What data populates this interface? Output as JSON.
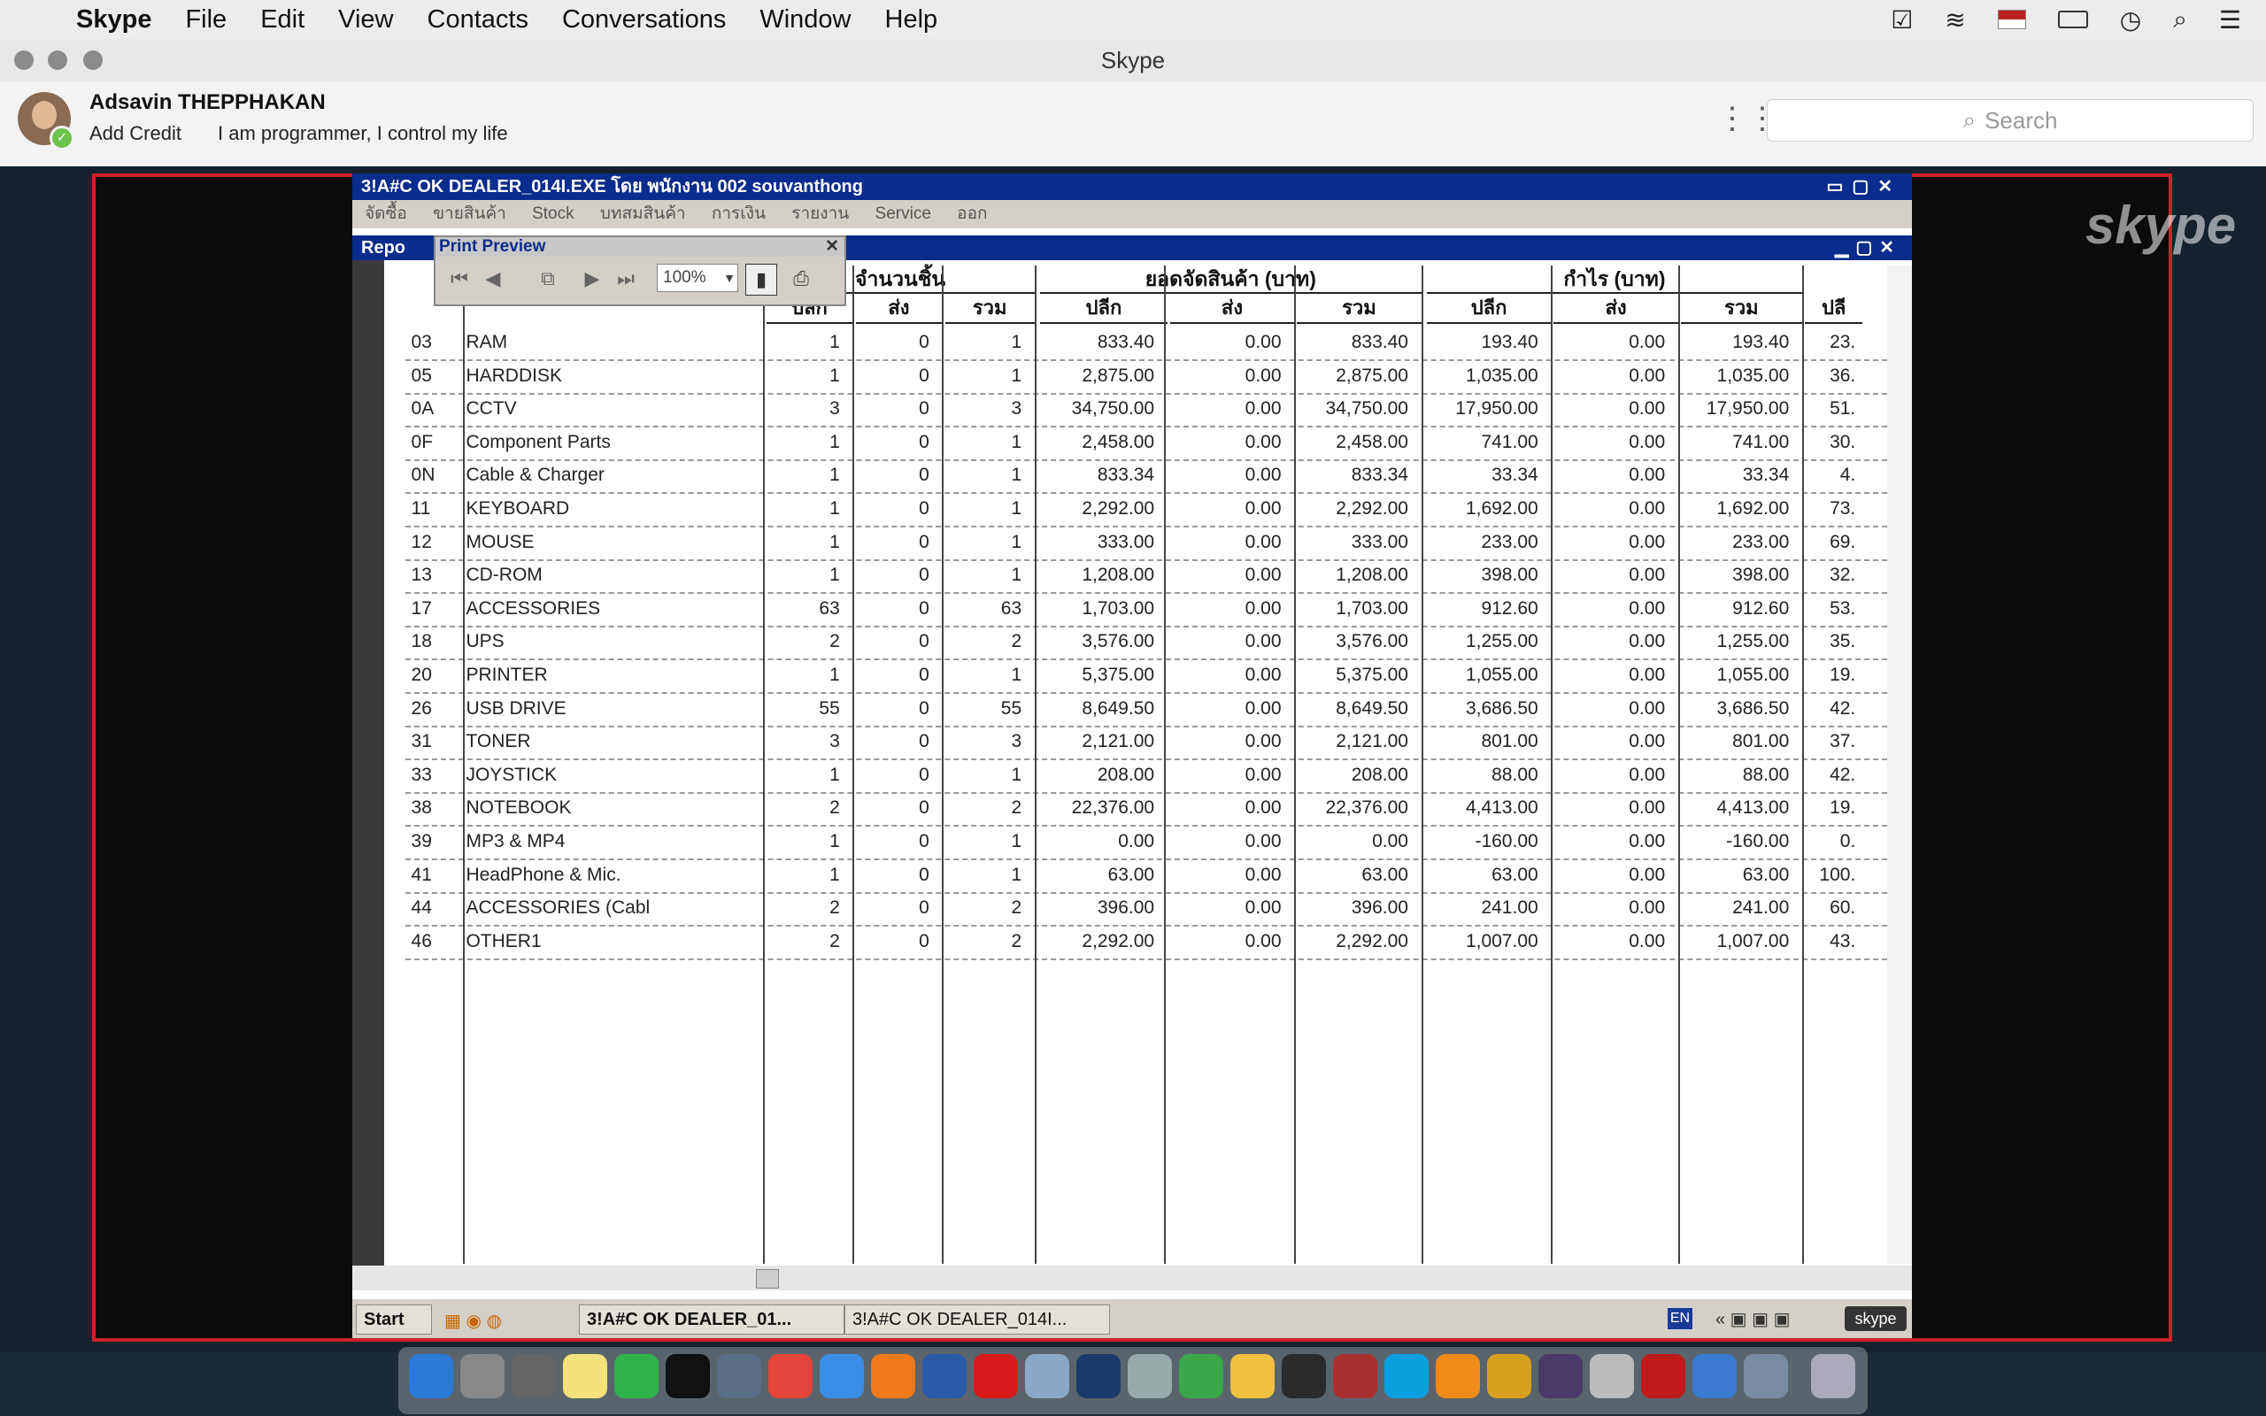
{
  "menubar": {
    "app": "Skype",
    "items": [
      "File",
      "Edit",
      "View",
      "Contacts",
      "Conversations",
      "Window",
      "Help"
    ]
  },
  "window": {
    "title": "Skype"
  },
  "profile": {
    "name": "Adsavin THEPPHAKAN",
    "add_credit": "Add Credit",
    "mood": "I am programmer, I control my life"
  },
  "search": {
    "placeholder": "Search"
  },
  "watermark": "skype",
  "app": {
    "title": "3!A#C OK DEALER_014I.EXE โดย พนักงาน 002 souvanthong",
    "menu": [
      "จัดซื้อ",
      "ขายสินค้า",
      "Stock",
      "บทสมสินค้า",
      "การเงิน",
      "รายงาน",
      "Service",
      "ออก"
    ],
    "report_label": "Repo",
    "print_preview": {
      "title": "Print Preview",
      "zoom": "100%"
    }
  },
  "table": {
    "groups": [
      "จำนวนชิ้น",
      "ยอดจัดสินค้า (บาท)",
      "กำไร (บาท)"
    ],
    "subheaders": [
      "ปลีก",
      "ส่ง",
      "รวม",
      "ปลีก",
      "ส่ง",
      "รวม",
      "ปลีก",
      "ส่ง",
      "รวม",
      "ปลี"
    ],
    "rows": [
      [
        "03",
        "RAM",
        "1",
        "0",
        "1",
        "833.40",
        "0.00",
        "833.40",
        "193.40",
        "0.00",
        "193.40",
        "23."
      ],
      [
        "05",
        "HARDDISK",
        "1",
        "0",
        "1",
        "2,875.00",
        "0.00",
        "2,875.00",
        "1,035.00",
        "0.00",
        "1,035.00",
        "36."
      ],
      [
        "0A",
        "CCTV",
        "3",
        "0",
        "3",
        "34,750.00",
        "0.00",
        "34,750.00",
        "17,950.00",
        "0.00",
        "17,950.00",
        "51."
      ],
      [
        "0F",
        "Component Parts",
        "1",
        "0",
        "1",
        "2,458.00",
        "0.00",
        "2,458.00",
        "741.00",
        "0.00",
        "741.00",
        "30."
      ],
      [
        "0N",
        "Cable & Charger",
        "1",
        "0",
        "1",
        "833.34",
        "0.00",
        "833.34",
        "33.34",
        "0.00",
        "33.34",
        "4."
      ],
      [
        "11",
        "KEYBOARD",
        "1",
        "0",
        "1",
        "2,292.00",
        "0.00",
        "2,292.00",
        "1,692.00",
        "0.00",
        "1,692.00",
        "73."
      ],
      [
        "12",
        "MOUSE",
        "1",
        "0",
        "1",
        "333.00",
        "0.00",
        "333.00",
        "233.00",
        "0.00",
        "233.00",
        "69."
      ],
      [
        "13",
        "CD-ROM",
        "1",
        "0",
        "1",
        "1,208.00",
        "0.00",
        "1,208.00",
        "398.00",
        "0.00",
        "398.00",
        "32."
      ],
      [
        "17",
        "ACCESSORIES",
        "63",
        "0",
        "63",
        "1,703.00",
        "0.00",
        "1,703.00",
        "912.60",
        "0.00",
        "912.60",
        "53."
      ],
      [
        "18",
        "UPS",
        "2",
        "0",
        "2",
        "3,576.00",
        "0.00",
        "3,576.00",
        "1,255.00",
        "0.00",
        "1,255.00",
        "35."
      ],
      [
        "20",
        "PRINTER",
        "1",
        "0",
        "1",
        "5,375.00",
        "0.00",
        "5,375.00",
        "1,055.00",
        "0.00",
        "1,055.00",
        "19."
      ],
      [
        "26",
        "USB DRIVE",
        "55",
        "0",
        "55",
        "8,649.50",
        "0.00",
        "8,649.50",
        "3,686.50",
        "0.00",
        "3,686.50",
        "42."
      ],
      [
        "31",
        "TONER",
        "3",
        "0",
        "3",
        "2,121.00",
        "0.00",
        "2,121.00",
        "801.00",
        "0.00",
        "801.00",
        "37."
      ],
      [
        "33",
        "JOYSTICK",
        "1",
        "0",
        "1",
        "208.00",
        "0.00",
        "208.00",
        "88.00",
        "0.00",
        "88.00",
        "42."
      ],
      [
        "38",
        "NOTEBOOK",
        "2",
        "0",
        "2",
        "22,376.00",
        "0.00",
        "22,376.00",
        "4,413.00",
        "0.00",
        "4,413.00",
        "19."
      ],
      [
        "39",
        "MP3 & MP4",
        "1",
        "0",
        "1",
        "0.00",
        "0.00",
        "0.00",
        "-160.00",
        "0.00",
        "-160.00",
        "0."
      ],
      [
        "41",
        "HeadPhone & Mic.",
        "1",
        "0",
        "1",
        "63.00",
        "0.00",
        "63.00",
        "63.00",
        "0.00",
        "63.00",
        "100."
      ],
      [
        "44",
        "ACCESSORIES (Cabl",
        "2",
        "0",
        "2",
        "396.00",
        "0.00",
        "396.00",
        "241.00",
        "0.00",
        "241.00",
        "60."
      ],
      [
        "46",
        "OTHER1",
        "2",
        "0",
        "2",
        "2,292.00",
        "0.00",
        "2,292.00",
        "1,007.00",
        "0.00",
        "1,007.00",
        "43."
      ]
    ]
  },
  "taskbar": {
    "start": "Start",
    "tasks": [
      "3!A#C OK DEALER_01...",
      "3!A#C OK DEALER_014I..."
    ],
    "lang": "EN",
    "skype_tray": "skype"
  }
}
